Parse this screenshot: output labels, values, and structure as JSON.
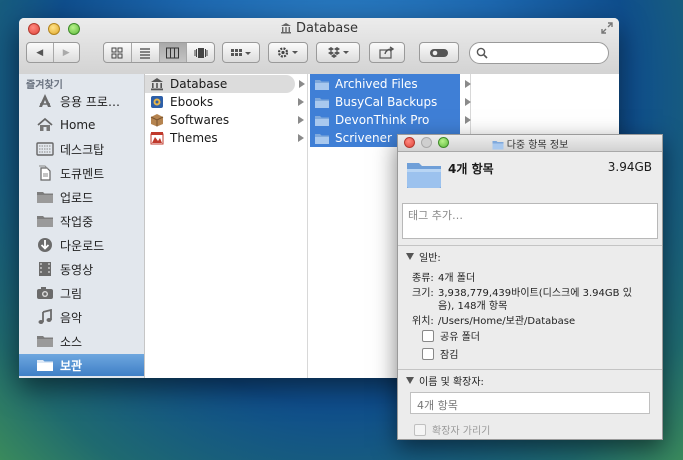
{
  "window": {
    "title": "Database"
  },
  "toolbar": {
    "back": "◀",
    "forward": "▶"
  },
  "sidebar": {
    "header": "즐겨찾기",
    "items": [
      {
        "label": "응용 프로…",
        "icon": "applications-icon"
      },
      {
        "label": "Home",
        "icon": "home-icon"
      },
      {
        "label": "데스크탑",
        "icon": "desktop-icon"
      },
      {
        "label": "도큐멘트",
        "icon": "documents-icon"
      },
      {
        "label": "업로드",
        "icon": "folder-icon"
      },
      {
        "label": "작업중",
        "icon": "folder-icon"
      },
      {
        "label": "다운로드",
        "icon": "downloads-icon"
      },
      {
        "label": "동영상",
        "icon": "movies-icon"
      },
      {
        "label": "그림",
        "icon": "pictures-icon"
      },
      {
        "label": "음악",
        "icon": "music-icon"
      },
      {
        "label": "소스",
        "icon": "folder-icon"
      },
      {
        "label": "보관",
        "icon": "folder-icon",
        "selected": true
      }
    ]
  },
  "column1": {
    "items": [
      {
        "label": "Database",
        "icon": "database-icon",
        "state": "parent-selected"
      },
      {
        "label": "Ebooks",
        "icon": "ebooks-icon"
      },
      {
        "label": "Softwares",
        "icon": "package-icon"
      },
      {
        "label": "Themes",
        "icon": "themes-icon"
      }
    ]
  },
  "column2": {
    "items": [
      {
        "label": "Archived Files"
      },
      {
        "label": "BusyCal Backups"
      },
      {
        "label": "DevonThink Pro"
      },
      {
        "label": "Scrivener"
      }
    ]
  },
  "info_panel": {
    "title": "다중 항목 정보",
    "count": "4개 항목",
    "size": "3.94GB",
    "tags_placeholder": "태그 추가…",
    "general_header": "일반:",
    "kind_label": "종류:",
    "kind_value": "4개 폴더",
    "size_label": "크기:",
    "size_value_line1": "3,938,779,439바이트(디스크에 3.94GB 있",
    "size_value_line2": "음), 148개 항목",
    "where_label": "위치:",
    "where_value": "/Users/Home/보관/Database",
    "shared_folder": "공유 폴더",
    "locked": "잠김",
    "name_header": "이름 및 확장자:",
    "name_value": "4개 항목",
    "hide_extension": "확장자 가리기"
  },
  "colors": {
    "selection_blue": "#3f7fd6",
    "sidebar_bg": "#e2e7ed",
    "folder_blue": "#8fb8e6"
  }
}
